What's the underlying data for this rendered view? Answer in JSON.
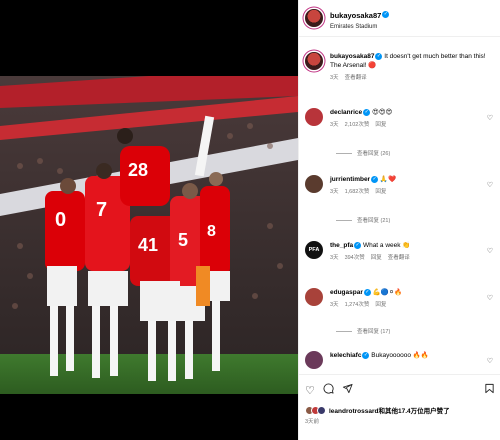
{
  "post": {
    "username": "bukayosaka87",
    "location": "Emirates Stadium"
  },
  "caption": {
    "username": "bukayosaka87",
    "text": "It doesn't get much better than this! The Arsenal! 🔴",
    "time": "3天",
    "translate": "查看翻译"
  },
  "comments": [
    {
      "username": "declanrice",
      "text": "😍😍😍",
      "time": "3天",
      "likes": "2,102次赞",
      "reply": "回复",
      "translate": "",
      "replies": "查看回复 (26)"
    },
    {
      "username": "jurrientimber",
      "text": "🙏❤️",
      "time": "3天",
      "likes": "1,682次赞",
      "reply": "回复",
      "translate": "",
      "replies": "查看回复 (21)"
    },
    {
      "username": "the_pfa",
      "text": "What a week 👏",
      "time": "3天",
      "likes": "394次赞",
      "reply": "回复",
      "translate": "查看翻译",
      "replies": ""
    },
    {
      "username": "edugaspar",
      "text": "💪🔵⚪🔥",
      "time": "3天",
      "likes": "1,274次赞",
      "reply": "回复",
      "translate": "",
      "replies": "查看回复 (17)"
    },
    {
      "username": "kelechiafc",
      "text": "Bukayoooooo 🔥🔥",
      "time": "3天",
      "likes": "",
      "reply": "",
      "translate": "",
      "replies": ""
    }
  ],
  "footer": {
    "likes_text": "leandrotrossard和其他17.4万位用户赞了",
    "time": "3天前"
  },
  "icons": {
    "like": "heart-outline-icon",
    "comment": "comment-bubble-icon",
    "share": "paper-plane-icon",
    "save": "bookmark-icon",
    "verified": "verified-badge-icon"
  },
  "colors": {
    "verified": "#0095f6",
    "arsenal_red": "#db0007",
    "meta_grey": "#737373"
  }
}
